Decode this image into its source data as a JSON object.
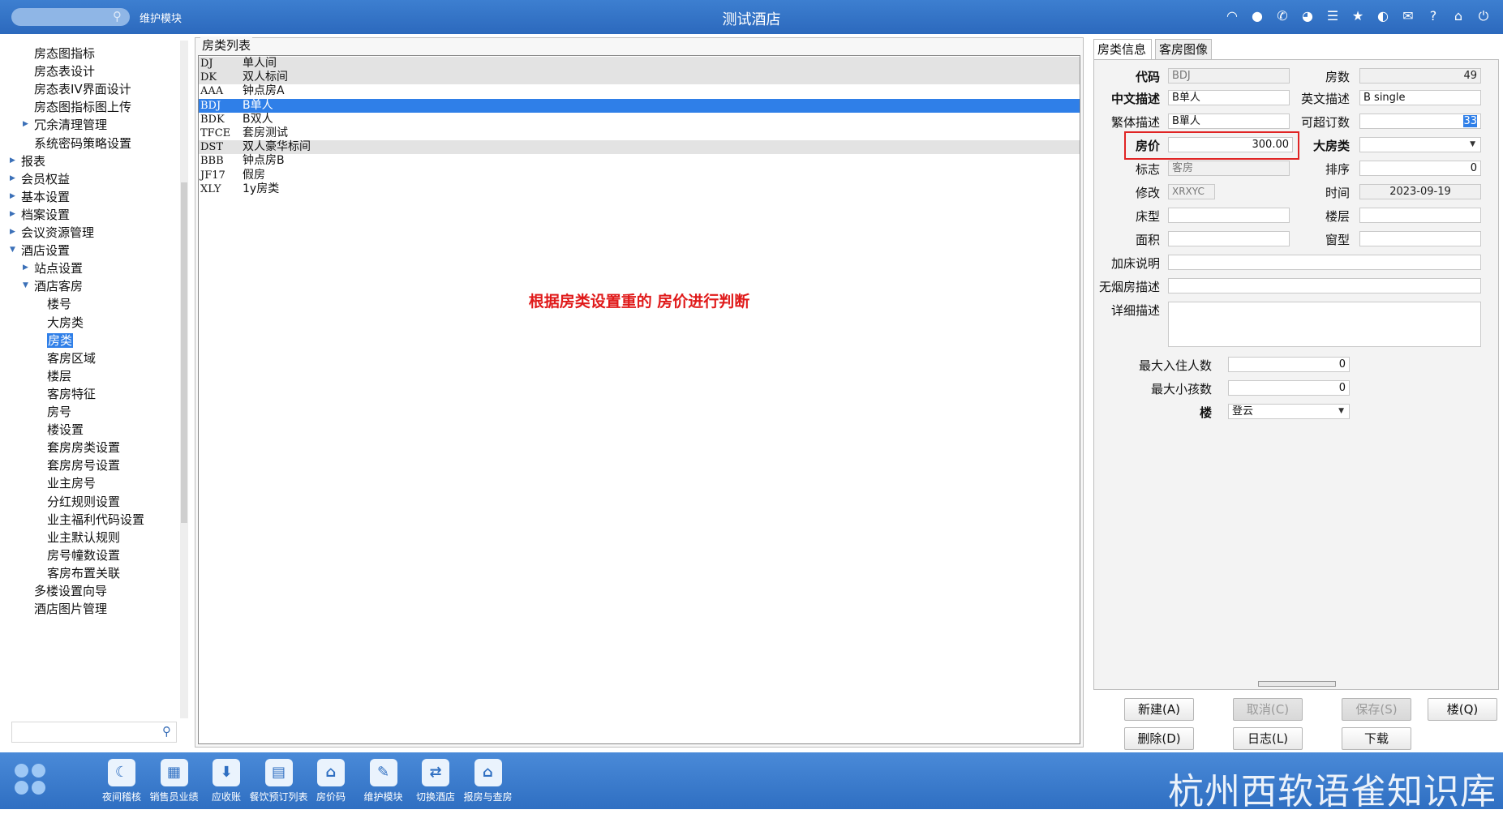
{
  "topbar": {
    "module_label": "维护模块",
    "title": "测试酒店",
    "icons": [
      "wifi-icon",
      "chat-icon",
      "phone-icon",
      "palette-icon",
      "menu-icon",
      "star-icon",
      "theme-icon",
      "mail-icon",
      "help-icon",
      "home-icon",
      "power-icon"
    ]
  },
  "tree": {
    "items": [
      {
        "label": "房态图指标",
        "level": 2,
        "arrow": ""
      },
      {
        "label": "房态表设计",
        "level": 2,
        "arrow": ""
      },
      {
        "label": "房态表IV界面设计",
        "level": 2,
        "arrow": ""
      },
      {
        "label": "房态图指标图上传",
        "level": 2,
        "arrow": ""
      },
      {
        "label": "冗余清理管理",
        "level": 2,
        "arrow": "▶"
      },
      {
        "label": "系统密码策略设置",
        "level": 2,
        "arrow": ""
      },
      {
        "label": "报表",
        "level": 1,
        "arrow": "▶"
      },
      {
        "label": "会员权益",
        "level": 1,
        "arrow": "▶"
      },
      {
        "label": "基本设置",
        "level": 1,
        "arrow": "▶"
      },
      {
        "label": "档案设置",
        "level": 1,
        "arrow": "▶"
      },
      {
        "label": "会议资源管理",
        "level": 1,
        "arrow": "▶"
      },
      {
        "label": "酒店设置",
        "level": 1,
        "arrow": "▼"
      },
      {
        "label": "站点设置",
        "level": 2,
        "arrow": "▶"
      },
      {
        "label": "酒店客房",
        "level": 2,
        "arrow": "▼"
      },
      {
        "label": "楼号",
        "level": 3,
        "arrow": ""
      },
      {
        "label": "大房类",
        "level": 3,
        "arrow": ""
      },
      {
        "label": "房类",
        "level": 3,
        "arrow": "",
        "selected": true
      },
      {
        "label": "客房区域",
        "level": 3,
        "arrow": ""
      },
      {
        "label": "楼层",
        "level": 3,
        "arrow": ""
      },
      {
        "label": "客房特征",
        "level": 3,
        "arrow": ""
      },
      {
        "label": "房号",
        "level": 3,
        "arrow": ""
      },
      {
        "label": "楼设置",
        "level": 3,
        "arrow": ""
      },
      {
        "label": "套房房类设置",
        "level": 3,
        "arrow": ""
      },
      {
        "label": "套房房号设置",
        "level": 3,
        "arrow": ""
      },
      {
        "label": "业主房号",
        "level": 3,
        "arrow": ""
      },
      {
        "label": "分红规则设置",
        "level": 3,
        "arrow": ""
      },
      {
        "label": "业主福利代码设置",
        "level": 3,
        "arrow": ""
      },
      {
        "label": "业主默认规则",
        "level": 3,
        "arrow": ""
      },
      {
        "label": "房号幢数设置",
        "level": 3,
        "arrow": ""
      },
      {
        "label": "客房布置关联",
        "level": 3,
        "arrow": ""
      },
      {
        "label": "多楼设置向导",
        "level": 2,
        "arrow": ""
      },
      {
        "label": "酒店图片管理",
        "level": 2,
        "arrow": ""
      }
    ],
    "search_value": ""
  },
  "list": {
    "legend": "房类列表",
    "rows": [
      {
        "code": "DJ",
        "name": "单人间",
        "style": "gray"
      },
      {
        "code": "DK",
        "name": "双人标间",
        "style": "gray"
      },
      {
        "code": "AAA",
        "name": "钟点房A",
        "style": ""
      },
      {
        "code": "BDJ",
        "name": "B单人",
        "style": "sel"
      },
      {
        "code": "BDK",
        "name": "B双人",
        "style": ""
      },
      {
        "code": "TFCE",
        "name": "套房测试",
        "style": ""
      },
      {
        "code": "DST",
        "name": "双人豪华标间",
        "style": "gray"
      },
      {
        "code": "BBB",
        "name": "钟点房B",
        "style": ""
      },
      {
        "code": "JF17",
        "name": "假房",
        "style": ""
      },
      {
        "code": "XLY",
        "name": "1y房类",
        "style": ""
      }
    ],
    "annotation": "根据房类设置重的 房价进行判断"
  },
  "tabs": {
    "info": "房类信息",
    "image": "客房图像"
  },
  "form": {
    "code_label": "代码",
    "code_value": "BDJ",
    "rooms_label": "房数",
    "rooms_value": "49",
    "cn_label": "中文描述",
    "cn_value": "B单人",
    "en_label": "英文描述",
    "en_value": "B single",
    "tw_label": "繁体描述",
    "tw_value": "B單人",
    "overbook_label": "可超订数",
    "overbook_value": "33",
    "price_label": "房价",
    "price_value": "300.00",
    "bigtype_label": "大房类",
    "bigtype_value": "",
    "flag_label": "标志",
    "flag_value": "客房",
    "order_label": "排序",
    "order_value": "0",
    "modify_label": "修改",
    "modify_value": "XRXYC",
    "time_label": "时间",
    "time_value": "2023-09-19",
    "bed_label": "床型",
    "bed_value": "",
    "floor_label": "楼层",
    "floor_value": "",
    "area_label": "面积",
    "area_value": "",
    "window_label": "窗型",
    "window_value": "",
    "extra_bed_label": "加床说明",
    "extra_bed_value": "",
    "nosmoke_label": "无烟房描述",
    "nosmoke_value": "",
    "detail_label": "详细描述",
    "detail_value": "",
    "max_guest_label": "最大入住人数",
    "max_guest_value": "0",
    "max_child_label": "最大小孩数",
    "max_child_value": "0",
    "building_label": "楼",
    "building_value": "登云"
  },
  "buttons": {
    "new": "新建(A)",
    "cancel": "取消(C)",
    "save": "保存(S)",
    "building": "楼(Q)",
    "delete": "删除(D)",
    "log": "日志(L)",
    "download": "下载"
  },
  "dock": [
    {
      "label": "夜间稽核",
      "icon": "moon-icon",
      "glyph": "☾"
    },
    {
      "label": "销售员业绩",
      "icon": "chart-icon",
      "glyph": "▦"
    },
    {
      "label": "应收账",
      "icon": "download-icon",
      "glyph": "⬇"
    },
    {
      "label": "餐饮预订列表",
      "icon": "list-icon",
      "glyph": "▤"
    },
    {
      "label": "房价码",
      "icon": "house-icon",
      "glyph": "⌂"
    },
    {
      "label": "维护模块",
      "icon": "wrench-icon",
      "glyph": "✎"
    },
    {
      "label": "切换酒店",
      "icon": "switch-icon",
      "glyph": "⇄"
    },
    {
      "label": "报房与查房",
      "icon": "house-search-icon",
      "glyph": "⌂"
    }
  ],
  "watermark": "杭州西软语雀知识库"
}
